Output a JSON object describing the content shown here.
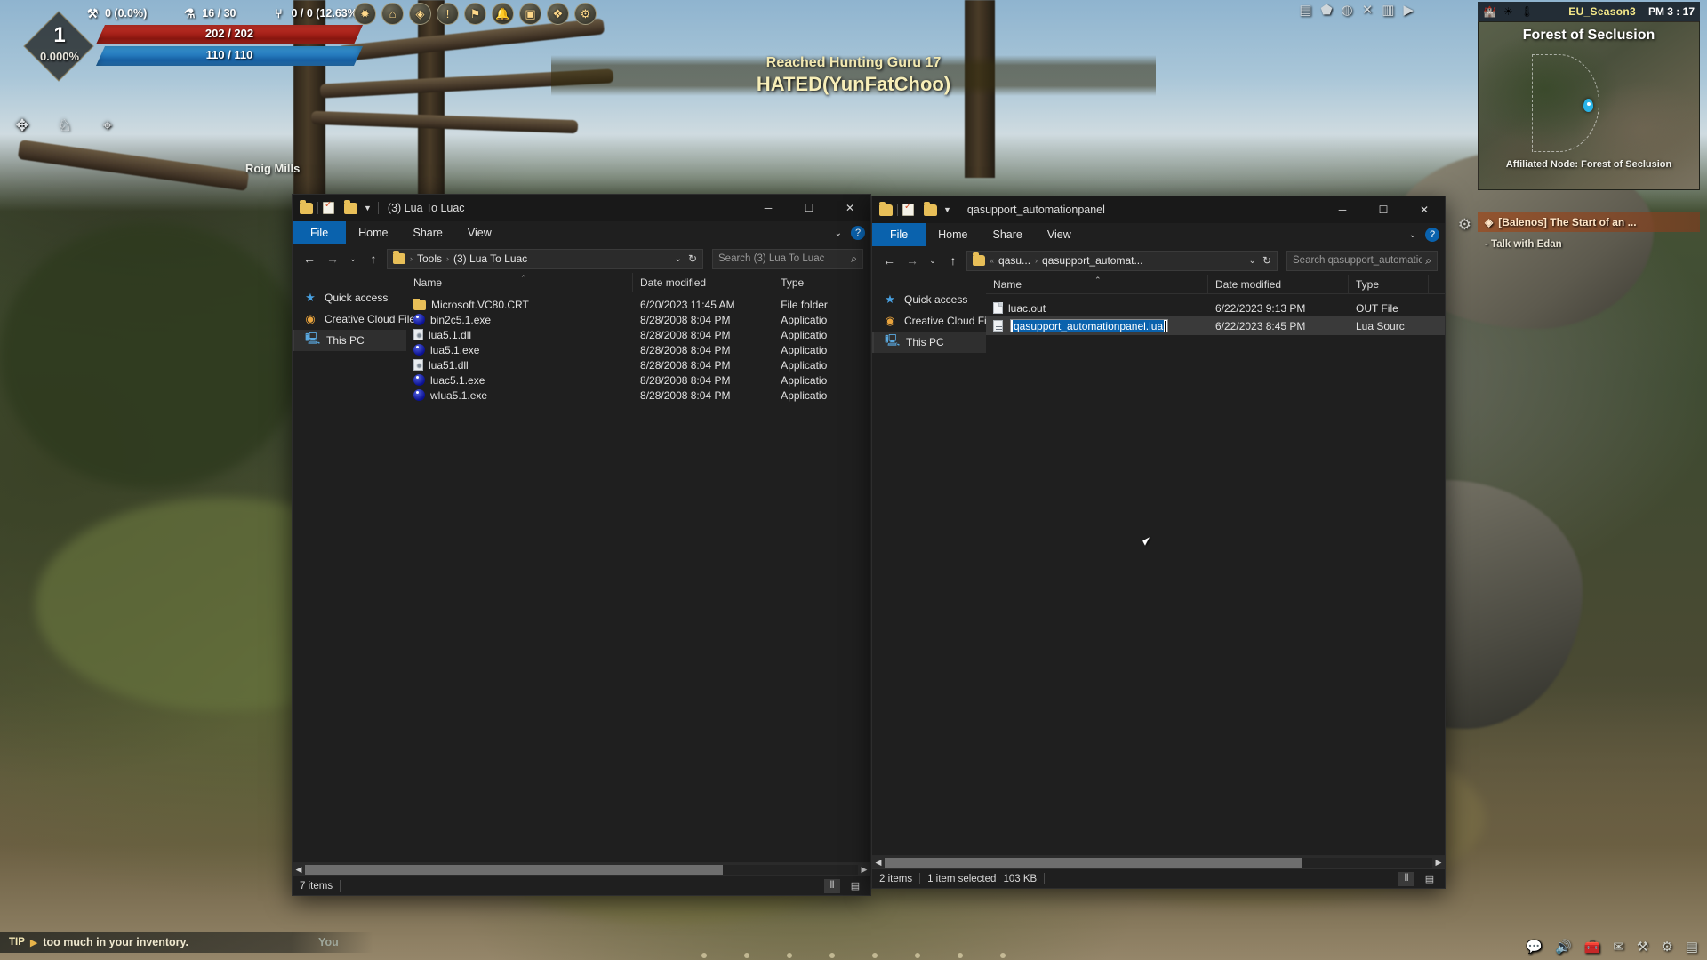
{
  "game": {
    "hud": {
      "level": "1",
      "level_pct": "0.000%",
      "hp": "202 / 202",
      "mp": "110 / 110",
      "stats": [
        {
          "icon": "crossed-tools-icon",
          "glyph": "⚒",
          "value": "0 (0.0%)"
        },
        {
          "icon": "potion-icon",
          "glyph": "⚗",
          "value": "16 / 30"
        },
        {
          "icon": "horn-icon",
          "glyph": "⑂",
          "value": "0 / 0 (12.63%)"
        }
      ],
      "skill_icons": [
        {
          "name": "pet-paw-icon",
          "glyph": "✥"
        },
        {
          "name": "horse-icon",
          "glyph": "♘"
        },
        {
          "name": "magnifier-tool-icon",
          "glyph": "⌖"
        }
      ],
      "center_icons": [
        {
          "name": "compass-icon",
          "glyph": "✹"
        },
        {
          "name": "market-icon",
          "glyph": "⌂"
        },
        {
          "name": "pearl-shop-icon",
          "glyph": "◈"
        },
        {
          "name": "quest-icon",
          "glyph": "!"
        },
        {
          "name": "guild-icon",
          "glyph": "⚑"
        },
        {
          "name": "bell-icon",
          "glyph": "🔔"
        },
        {
          "name": "bag-icon",
          "glyph": "▣"
        },
        {
          "name": "codex-icon",
          "glyph": "❖"
        },
        {
          "name": "gear-menu-icon",
          "glyph": "⚙"
        }
      ],
      "right_icons": [
        {
          "name": "screenshot-icon",
          "glyph": "▤"
        },
        {
          "name": "shield-icon",
          "glyph": "⬟"
        },
        {
          "name": "globe-icon",
          "glyph": "◍"
        },
        {
          "name": "close-x-icon",
          "glyph": "✕"
        },
        {
          "name": "video-icon",
          "glyph": "▥"
        },
        {
          "name": "play-icon",
          "glyph": "▶"
        }
      ]
    },
    "notification": {
      "line1": "Reached Hunting Guru 17",
      "line2": "HATED(YunFatChoo)"
    },
    "world_label": "Roig Mills",
    "minimap": {
      "server": "EU_Season3",
      "time": "PM 3 : 17",
      "region": "Forest of Seclusion",
      "node": "Affiliated Node: Forest of Seclusion",
      "top_icons": [
        {
          "name": "castle-icon",
          "glyph": "🏰"
        },
        {
          "name": "sun-weather-icon",
          "glyph": "☀"
        },
        {
          "name": "temperature-icon",
          "glyph": "🌡"
        }
      ]
    },
    "quest": {
      "icon": "quest-diamond-icon",
      "title": "[Balenos] The Start of an ...",
      "objective": "- Talk with Edan"
    },
    "tip": {
      "tag": "TIP",
      "arrow": "▶",
      "text": "too much in your inventory.",
      "faded": "You"
    },
    "tray_icons": [
      {
        "name": "chat-icon",
        "glyph": "💬"
      },
      {
        "name": "voice-icon",
        "glyph": "🔊"
      },
      {
        "name": "inventory-icon",
        "glyph": "🧰"
      },
      {
        "name": "mail-icon",
        "glyph": "✉"
      },
      {
        "name": "tools-icon",
        "glyph": "⚒"
      },
      {
        "name": "settings-icon",
        "glyph": "⚙"
      },
      {
        "name": "menu-icon",
        "glyph": "▤"
      }
    ],
    "colors": {
      "hp": "#c0281f",
      "mp": "#2f86cf",
      "accent": "#f2e8b0",
      "quest": "#96502a"
    }
  },
  "windows": [
    {
      "id": "lua-to-luac",
      "title": "(3) Lua To Luac",
      "quick_access_icons": [
        {
          "name": "folder-qat-icon"
        },
        {
          "name": "properties-qat-icon"
        },
        {
          "name": "new-folder-qat-icon"
        }
      ],
      "controls": {
        "minimize": "─",
        "maximize": "☐",
        "close": "✕"
      },
      "ribbon": {
        "tabs": [
          "File",
          "Home",
          "Share",
          "View"
        ],
        "chevron": "⌄",
        "help": "?"
      },
      "nav": {
        "back": "←",
        "forward": "→",
        "recent": "⌄",
        "up": "↑"
      },
      "address": {
        "crumbs": [
          "Tools",
          "(3) Lua To Luac"
        ],
        "dropdown": "⌄",
        "refresh": "↻"
      },
      "search": {
        "placeholder": "Search (3) Lua To Luac",
        "value": "",
        "icon": "search-icon"
      },
      "nav_pane": [
        {
          "label": "Quick access",
          "icon": "star-icon",
          "glyph": "★",
          "selected": false
        },
        {
          "label": "Creative Cloud Files",
          "icon": "creative-cloud-icon",
          "glyph": "◉",
          "selected": false
        },
        {
          "label": "This PC",
          "icon": "monitor-icon",
          "glyph": "🖥",
          "selected": true
        }
      ],
      "columns": [
        "Name",
        "Date modified",
        "Type"
      ],
      "sort_column": "Name",
      "files": [
        {
          "name": "Microsoft.VC80.CRT",
          "date": "6/20/2023 11:45 AM",
          "type": "File folder",
          "icon": "folder"
        },
        {
          "name": "bin2c5.1.exe",
          "date": "8/28/2008 8:04 PM",
          "type": "Applicatio",
          "icon": "exe"
        },
        {
          "name": "lua5.1.dll",
          "date": "8/28/2008 8:04 PM",
          "type": "Applicatio",
          "icon": "dll"
        },
        {
          "name": "lua5.1.exe",
          "date": "8/28/2008 8:04 PM",
          "type": "Applicatio",
          "icon": "exe"
        },
        {
          "name": "lua51.dll",
          "date": "8/28/2008 8:04 PM",
          "type": "Applicatio",
          "icon": "dll"
        },
        {
          "name": "luac5.1.exe",
          "date": "8/28/2008 8:04 PM",
          "type": "Applicatio",
          "icon": "exe"
        },
        {
          "name": "wlua5.1.exe",
          "date": "8/28/2008 8:04 PM",
          "type": "Applicatio",
          "icon": "exe"
        }
      ],
      "status": {
        "items": "7 items",
        "selection": "",
        "size": ""
      }
    },
    {
      "id": "qasupport-automationpanel",
      "title": "qasupport_automationpanel",
      "controls": {
        "minimize": "─",
        "maximize": "☐",
        "close": "✕"
      },
      "ribbon": {
        "tabs": [
          "File",
          "Home",
          "Share",
          "View"
        ],
        "chevron": "⌄",
        "help": "?"
      },
      "nav": {
        "back": "←",
        "forward": "→",
        "recent": "⌄",
        "up": "↑"
      },
      "address": {
        "crumbs": [
          "qasu...",
          "qasupport_automat..."
        ],
        "overflow": "«",
        "dropdown": "⌄",
        "refresh": "↻"
      },
      "search": {
        "placeholder": "Search qasupport_automatio...",
        "value": "",
        "icon": "search-icon"
      },
      "nav_pane": [
        {
          "label": "Quick access",
          "icon": "star-icon",
          "glyph": "★",
          "selected": false
        },
        {
          "label": "Creative Cloud Files",
          "icon": "creative-cloud-icon",
          "glyph": "◉",
          "selected": false
        },
        {
          "label": "This PC",
          "icon": "monitor-icon",
          "glyph": "🖥",
          "selected": true
        }
      ],
      "columns": [
        "Name",
        "Date modified",
        "Type"
      ],
      "sort_column": "Name",
      "files": [
        {
          "name": "luac.out",
          "date": "6/22/2023 9:13 PM",
          "type": "OUT File",
          "icon": "out"
        },
        {
          "name": "qasupport_automationpanel.lua",
          "date": "6/22/2023 8:45 PM",
          "type": "Lua Sourc",
          "icon": "lua",
          "renaming": true
        }
      ],
      "rename_value": "qasupport_automationpanel.lua",
      "status": {
        "items": "2 items",
        "selection": "1 item selected",
        "size": "103 KB"
      }
    }
  ]
}
